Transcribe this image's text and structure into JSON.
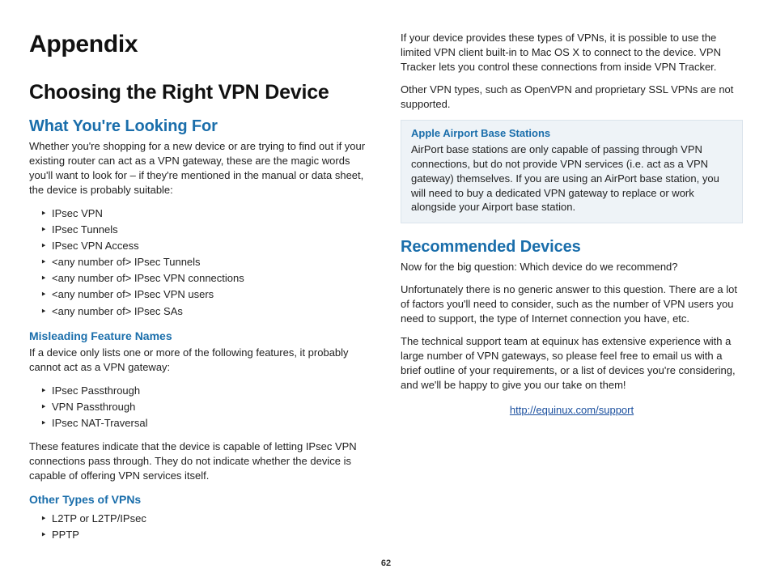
{
  "page_number": "62",
  "left": {
    "h1": "Appendix",
    "h2": "Choosing the Right VPN Device",
    "h3_looking": "What You're Looking For",
    "p_looking": "Whether you're shopping for a new device or are trying to find out if your existing router can act as a VPN gateway, these are the magic words you'll want to look for – if they're mentioned in the manual or data sheet, the device is probably suitable:",
    "list_looking": [
      "IPsec VPN",
      "IPsec Tunnels",
      "IPsec VPN Access",
      "<any number of> IPsec Tunnels",
      "<any number of> IPsec VPN connections",
      "<any number of> IPsec VPN users",
      "<any number of> IPsec SAs"
    ],
    "h4_misleading": "Misleading Feature Names",
    "p_misleading": "If a device only lists one or more of the following features, it probably cannot act as a VPN gateway:",
    "list_misleading": [
      "IPsec Passthrough",
      "VPN Passthrough",
      "IPsec NAT-Traversal"
    ],
    "p_misleading_after": "These features indicate that the device is capable of letting IPsec VPN connections pass through. They do not indicate whether the device is capable of offering VPN services itself.",
    "h4_other": "Other Types of VPNs",
    "list_other": [
      "L2TP or L2TP/IPsec",
      "PPTP"
    ]
  },
  "right": {
    "p_top1": "If your device provides these types of VPNs, it is possible to use the limited VPN client built-in to Mac OS X to connect to the device. VPN Tracker lets you control these connections from inside VPN Tracker.",
    "p_top2": "Other VPN types, such as OpenVPN and proprietary SSL VPNs are not supported.",
    "callout_title": "Apple Airport Base Stations",
    "callout_body": "AirPort base stations are only capable of passing through VPN connections, but do not provide VPN services (i.e. act as a VPN gateway) themselves. If you are using an AirPort base station, you will need to buy a dedicated VPN gateway to replace or work alongside your Airport base station.",
    "h3_rec": "Recommended Devices",
    "p_rec1": "Now for the big question: Which device do we recommend?",
    "p_rec2": "Unfortunately there is no generic answer to this question. There are a lot of factors you'll need to consider, such as the number of VPN users you need to support, the type of Internet connection you have, etc.",
    "p_rec3": "The technical support team at equinux has extensive experience with a large number of VPN gateways, so please feel free to email us with a brief outline of your requirements, or a list of devices you're considering, and we'll be happy to give you our take on them!",
    "support_link": "http://equinux.com/support"
  }
}
